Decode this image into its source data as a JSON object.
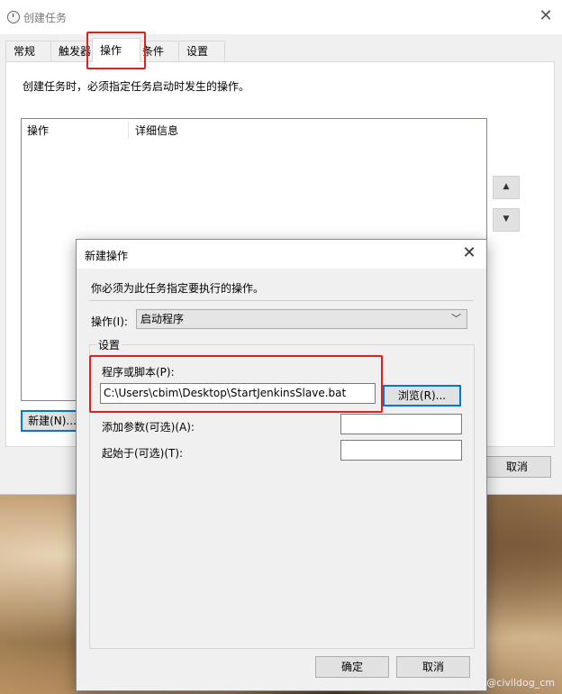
{
  "window": {
    "title": "创建任务",
    "close_glyph": "✕",
    "tabs": [
      "常规",
      "触发器",
      "操作",
      "条件",
      "设置"
    ],
    "active_tab": "操作",
    "panel_description": "创建任务时，必须指定任务启动时发生的操作。",
    "list_columns": [
      "操作",
      "详细信息"
    ],
    "new_button": "新建(N)...",
    "cancel_button": "取消",
    "move_up_glyph": "▲",
    "move_down_glyph": "▼"
  },
  "dialog": {
    "title": "新建操作",
    "close_glyph": "✕",
    "description": "你必须为此任务指定要执行的操作。",
    "action_label": "操作(I):",
    "action_value": "启动程序",
    "settings_label": "设置",
    "program_label": "程序或脚本(P):",
    "program_value": "C:\\Users\\cbim\\Desktop\\StartJenkinsSlave.bat",
    "browse_button": "浏览(R)...",
    "args_label": "添加参数(可选)(A):",
    "args_value": "",
    "start_in_label": "起始于(可选)(T):",
    "start_in_value": "",
    "ok_button": "确定",
    "cancel_button": "取消"
  },
  "watermark": "CSDN @civildog_cm",
  "colors": {
    "highlight": "#e02020",
    "focus": "#0078d7"
  }
}
